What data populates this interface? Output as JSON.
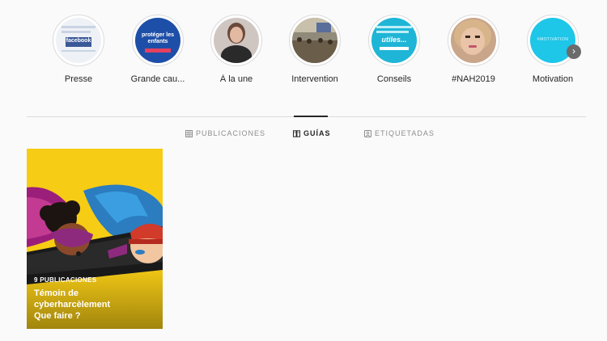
{
  "highlights": [
    {
      "label": "Presse",
      "thumb_text": "facebook"
    },
    {
      "label": "Grande cau...",
      "thumb_text": "protéger les enfants"
    },
    {
      "label": "À la une",
      "thumb_text": ""
    },
    {
      "label": "Intervention",
      "thumb_text": ""
    },
    {
      "label": "Conseils",
      "thumb_text": "utiles..."
    },
    {
      "label": "#NAH2019",
      "thumb_text": ""
    },
    {
      "label": "Motivation",
      "thumb_text": "#MOTIVATION"
    }
  ],
  "tabs": [
    {
      "label": "PUBLICACIONES",
      "icon": "grid-icon",
      "active": false
    },
    {
      "label": "GUÍAS",
      "icon": "guide-icon",
      "active": true
    },
    {
      "label": "ETIQUETADAS",
      "icon": "tagged-icon",
      "active": false
    }
  ],
  "guide": {
    "count_label": "9 PUBLICACIONES",
    "title": "Témoin de cyberharcèlement Que faire ?"
  },
  "colors": {
    "background": "#fafafa",
    "divider": "#dbdbdb",
    "muted_text": "#8e8e8e",
    "card_yellow": "#f7cc15"
  }
}
